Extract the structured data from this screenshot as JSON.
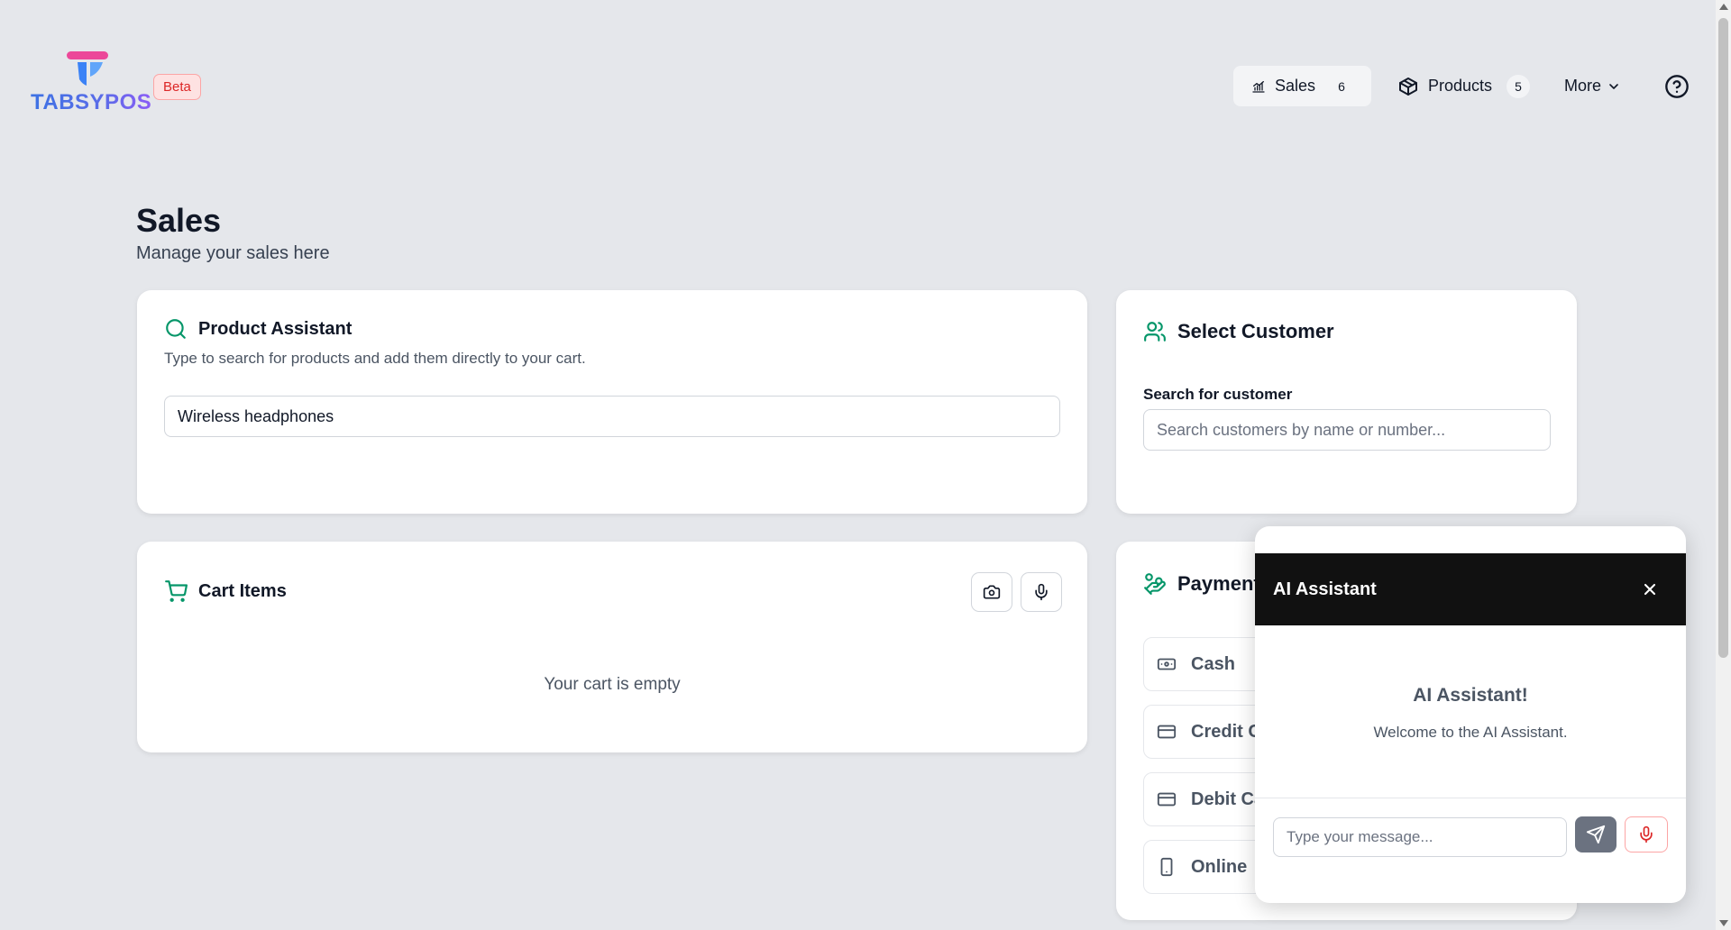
{
  "app": {
    "logo_text": "TABSYPOS",
    "beta_label": "Beta"
  },
  "nav": {
    "sales": {
      "label": "Sales",
      "count": "6"
    },
    "products": {
      "label": "Products",
      "count": "5"
    },
    "more": {
      "label": "More"
    }
  },
  "page": {
    "title": "Sales",
    "subtitle": "Manage your sales here"
  },
  "product_assistant": {
    "title": "Product Assistant",
    "description": "Type to search for products and add them directly to your cart.",
    "search_value": "Wireless headphones"
  },
  "customer": {
    "title": "Select Customer",
    "search_label": "Search for customer",
    "search_placeholder": "Search customers by name or number..."
  },
  "cart": {
    "title": "Cart Items",
    "empty_text": "Your cart is empty"
  },
  "payment": {
    "title": "Payment",
    "options": [
      "Cash",
      "Credit C",
      "Debit Ca",
      "Online"
    ]
  },
  "ai_assistant": {
    "header_title": "AI Assistant",
    "welcome_title": "AI Assistant!",
    "welcome_text": "Welcome to the AI Assistant.",
    "input_placeholder": "Type your message..."
  },
  "colors": {
    "accent_green": "#059669",
    "page_bg": "#e5e7eb",
    "logo_pink": "#ec4899",
    "logo_blue": "#3b82f6",
    "beta_red": "#dc2626",
    "ai_header_bg": "#111111"
  },
  "icons": {
    "sales": "chart-bars-icon",
    "products": "package-icon",
    "more": "chevron-down-icon",
    "help": "help-circle-icon",
    "product_assistant": "search-icon",
    "customer": "users-icon",
    "cart": "shopping-cart-icon",
    "payment": "hand-coins-icon",
    "camera": "camera-icon",
    "mic": "mic-icon",
    "cash": "banknote-icon",
    "credit": "credit-card-icon",
    "debit": "credit-card-icon",
    "online": "smartphone-icon",
    "close": "close-icon",
    "send": "send-icon"
  }
}
